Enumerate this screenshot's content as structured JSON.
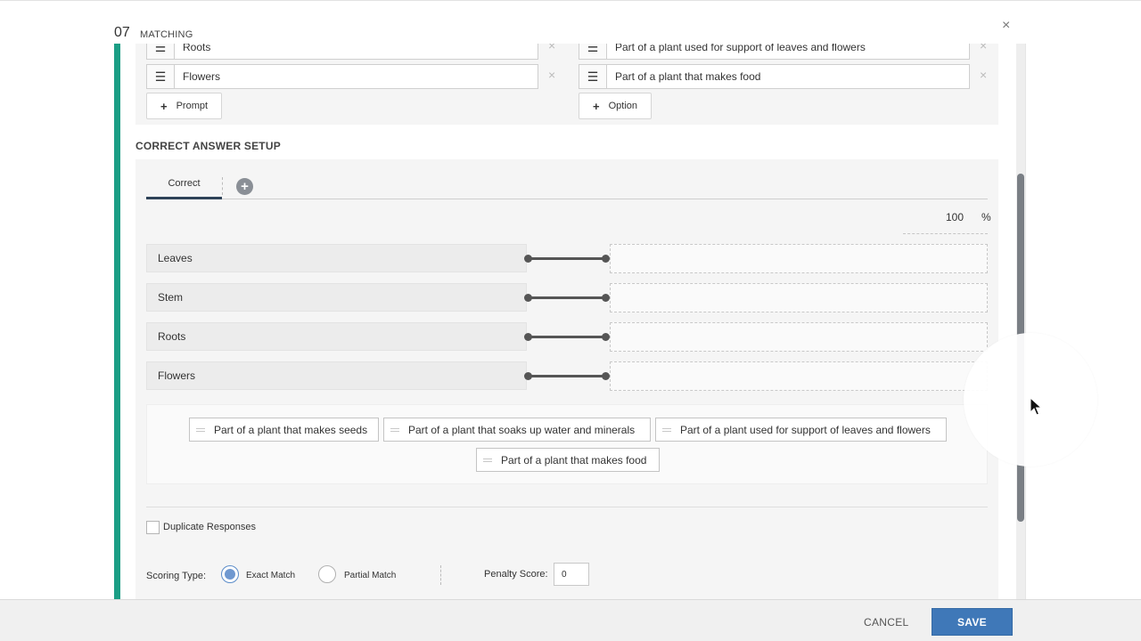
{
  "header": {
    "question_number": "07",
    "question_type": "MATCHING",
    "close_label": "×"
  },
  "prompts_editor": {
    "prompts": [
      "Roots",
      "Flowers"
    ],
    "options": [
      "Part of a plant used for support of leaves and flowers",
      "Part of a plant that makes food"
    ],
    "add_prompt_label": "Prompt",
    "add_option_label": "Option",
    "remove_label": "×"
  },
  "correct_answer": {
    "section_title": "CORRECT ANSWER SETUP",
    "tabs": [
      {
        "label": "Correct"
      }
    ],
    "add_tab_label": "+",
    "score_value": "100",
    "score_unit": "%",
    "stems": [
      "Leaves",
      "Stem",
      "Roots",
      "Flowers"
    ],
    "possible_responses": [
      "Part of a plant that makes seeds",
      "Part of a plant that soaks up water and minerals",
      "Part of a plant used for support of leaves and flowers",
      "Part of a plant that makes food"
    ]
  },
  "options": {
    "duplicate_responses_label": "Duplicate Responses",
    "duplicate_responses_checked": false,
    "scoring_type_label": "Scoring Type:",
    "scoring_types": [
      "Exact Match",
      "Partial Match"
    ],
    "selected_scoring_type": "Exact Match",
    "penalty_label": "Penalty Score:",
    "penalty_value": "0"
  },
  "footer": {
    "cancel_label": "CANCEL",
    "save_label": "SAVE"
  },
  "colors": {
    "accent": "#1b9e85",
    "primary_button": "#3f78b8",
    "tab_underline": "#2e4258",
    "radio_selected": "#6f98d0"
  },
  "icons": {
    "drag_handle": "hamburger-icon",
    "add": "plus-icon",
    "close": "close-icon",
    "remove": "remove-icon",
    "cursor": "mouse-pointer-icon"
  }
}
